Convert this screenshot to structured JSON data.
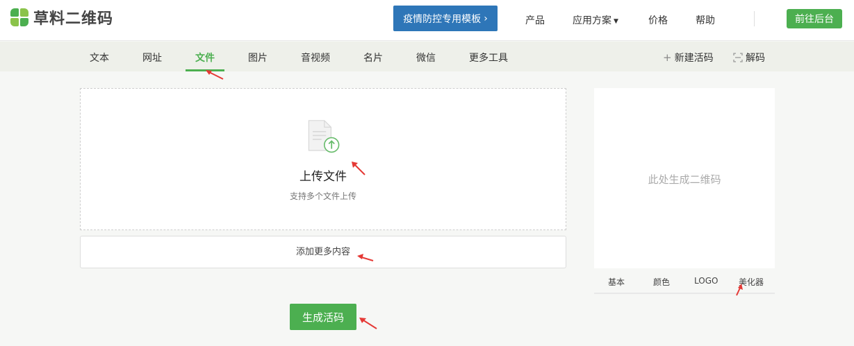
{
  "header": {
    "logo_text": "草料二维码",
    "promo_label": "疫情防控专用模板",
    "promo_chevron": "›",
    "nav": [
      {
        "label": "产品"
      },
      {
        "label": "应用方案",
        "has_dropdown": true
      },
      {
        "label": "价格"
      },
      {
        "label": "帮助"
      }
    ],
    "console_label": "前往后台"
  },
  "subnav": {
    "items": [
      {
        "label": "文本"
      },
      {
        "label": "网址"
      },
      {
        "label": "文件",
        "active": true
      },
      {
        "label": "图片"
      },
      {
        "label": "音视频"
      },
      {
        "label": "名片"
      },
      {
        "label": "微信"
      },
      {
        "label": "更多工具"
      }
    ],
    "new_live_code": "新建活码",
    "decode": "解码"
  },
  "upload": {
    "title": "上传文件",
    "subtitle": "支持多个文件上传"
  },
  "add_more_label": "添加更多内容",
  "generate_label": "生成活码",
  "qr": {
    "placeholder": "此处生成二维码",
    "tabs": [
      {
        "label": "基本"
      },
      {
        "label": "颜色"
      },
      {
        "label": "LOGO"
      },
      {
        "label": "美化器"
      }
    ]
  },
  "colors": {
    "brand_green": "#4caf50",
    "promo_blue": "#2e76b8",
    "annotation_red": "#e53935"
  },
  "icons": {
    "logo": "caoliao-logo-icon",
    "upload": "file-upload-icon",
    "plus": "plus-icon",
    "decode": "scan-icon",
    "dropdown": "chevron-down-icon"
  }
}
